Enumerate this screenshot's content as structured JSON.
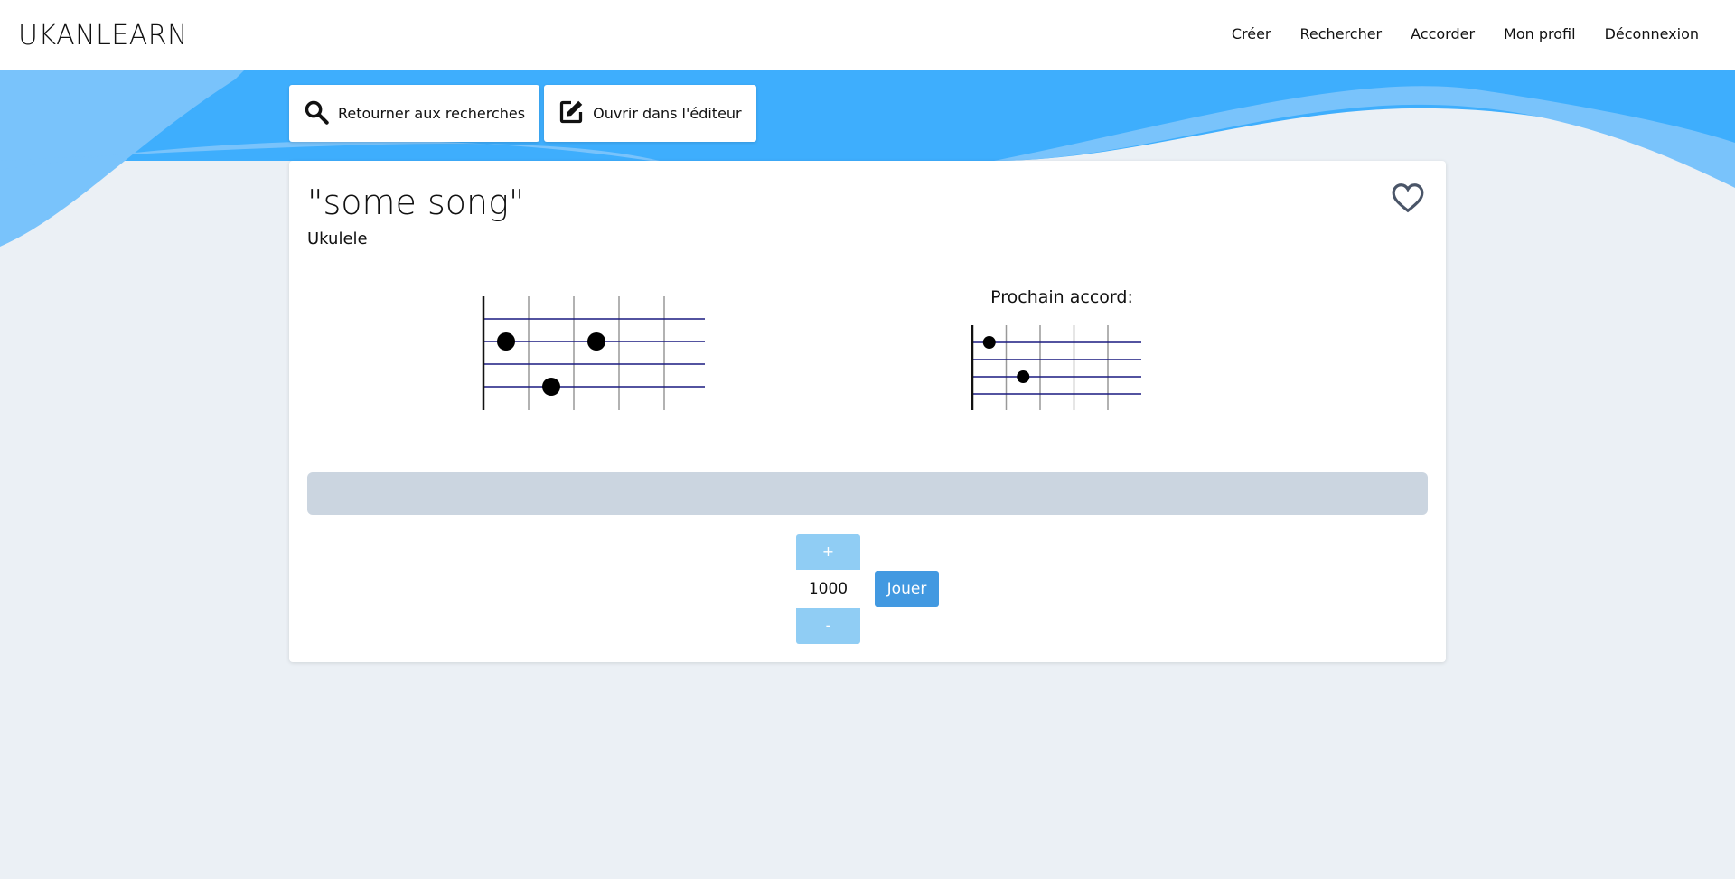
{
  "nav": {
    "brand": "UKANLEARN",
    "links": [
      "Créer",
      "Rechercher",
      "Accorder",
      "Mon profil",
      "Déconnexion"
    ]
  },
  "toolbar": {
    "back_label": "Retourner aux recherches",
    "back_icon": "search-icon",
    "edit_label": "Ouvrir dans l'éditeur",
    "edit_icon": "edit-icon"
  },
  "song": {
    "title": "\"some song\"",
    "instrument": "Ukulele",
    "favorite_icon": "heart-outline-icon"
  },
  "current_chord": {
    "strings": 4,
    "frets": 4,
    "dots": [
      {
        "string": 2,
        "fret": 1
      },
      {
        "string": 2,
        "fret": 3
      },
      {
        "string": 4,
        "fret": 2
      }
    ]
  },
  "next_chord": {
    "label": "Prochain accord:",
    "strings": 4,
    "frets": 4,
    "dots": [
      {
        "string": 1,
        "fret": 1
      },
      {
        "string": 3,
        "fret": 2
      }
    ]
  },
  "controls": {
    "increment_label": "+",
    "decrement_label": "-",
    "tempo_value": "1000",
    "play_label": "Jouer"
  },
  "colors": {
    "accent": "#4299e1",
    "wave_dark": "#3eaefd",
    "wave_light": "#79c3fb",
    "string_line": "#1a1a80",
    "progress_track": "#cbd5e0"
  }
}
